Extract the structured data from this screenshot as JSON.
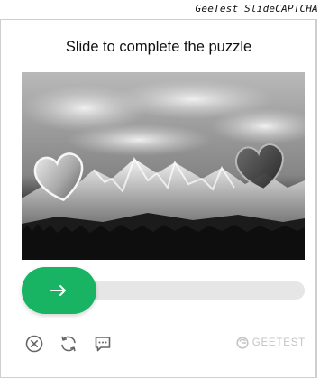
{
  "corner_label": "GeeTest SlideCAPTCHA",
  "captcha": {
    "title": "Slide to complete the puzzle",
    "slider": {
      "progress": 0.05,
      "handle_icon": "arrow-right-icon"
    },
    "toolbar": {
      "close_icon": "close-circle-icon",
      "refresh_icon": "refresh-icon",
      "feedback_icon": "feedback-icon"
    },
    "brand": {
      "icon": "geetest-logo-icon",
      "text": "GEETEST"
    }
  },
  "colors": {
    "accent": "#18b464",
    "track": "#e6e6e6",
    "brand": "#c4c4c4"
  }
}
